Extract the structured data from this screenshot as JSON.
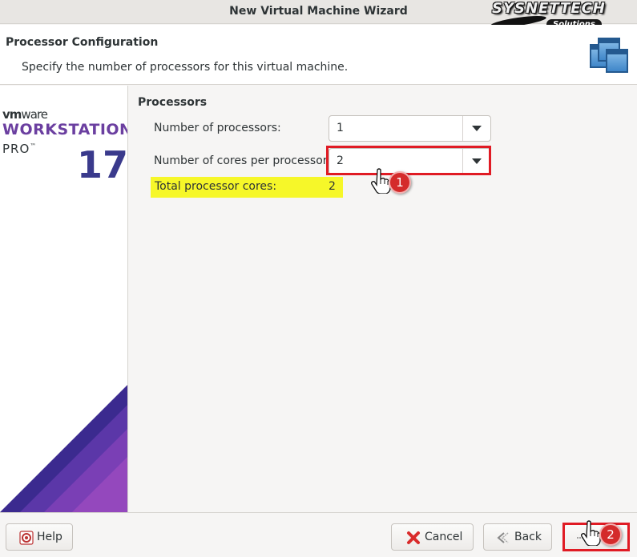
{
  "window": {
    "title": "New Virtual Machine Wizard"
  },
  "watermark": {
    "brand": "SYSNETTECH",
    "sub": "Solutions"
  },
  "header": {
    "title": "Processor Configuration",
    "description": "Specify the number of processors for this virtual machine."
  },
  "sidebar": {
    "logo_vm": "vm",
    "logo_ware": "ware",
    "product": "WORKSTATION",
    "edition": "PRO",
    "trademark": "™",
    "version": "17"
  },
  "processors": {
    "section_title": "Processors",
    "num_processors_label": "Number of processors:",
    "num_processors_value": "1",
    "cores_label": "Number of cores per processor:",
    "cores_value": "2",
    "total_label": "Total processor cores:",
    "total_value": "2"
  },
  "annotations": {
    "step1": "1",
    "step2": "2"
  },
  "footer": {
    "help_label": "Help",
    "cancel_label": "Cancel",
    "back_label": "Back"
  },
  "colors": {
    "highlight_red": "#e01b24",
    "highlight_yellow": "#f6f729",
    "vmware_purple": "#6b3fa0"
  },
  "icons": [
    "wizard-windows-icon",
    "chevron-down-icon",
    "help-icon",
    "cancel-x-icon",
    "back-arrow-icon",
    "hand-cursor-icon"
  ]
}
